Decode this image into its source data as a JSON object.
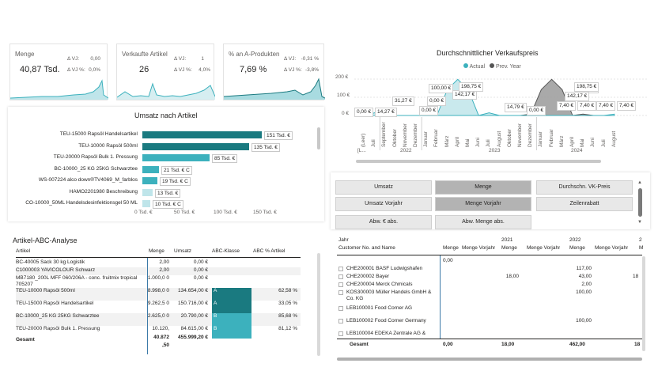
{
  "kpis": [
    {
      "title": "Menge",
      "value": "40,87 Tsd.",
      "d1_label": "Δ VJ:",
      "d1_value": "0,00",
      "d2_label": "Δ VJ %:",
      "d2_value": "0,0%"
    },
    {
      "title": "Verkaufte Artikel",
      "value": "26",
      "d1_label": "Δ VJ:",
      "d1_value": "1",
      "d2_label": "Δ VJ %:",
      "d2_value": "4,0%"
    },
    {
      "title": "% an A-Produkten",
      "value": "7,69 %",
      "d1_label": "Δ VJ:",
      "d1_value": "-0,31 %",
      "d2_label": "Δ VJ %:",
      "d2_value": "-3,8%"
    }
  ],
  "umsatz": {
    "title": "Umsatz nach Artikel",
    "chart_data": {
      "type": "bar",
      "categories": [
        "TEU-15000 Rapsöl Handelsartikel",
        "TEU-10000 Rapsöl 500ml",
        "TEU-20000 Rapsöl Bulk 1. Pressung",
        "BC-10000_25 KG 25KG Schwarztee",
        "WS-007224 alco down®TV4069_M_farblos",
        "HAMO2201980 Beschreibung",
        "CO-10000_50ML Handelsdesinfektionsgel 50 ML"
      ],
      "values": [
        151,
        135,
        85,
        21,
        19,
        13,
        10
      ],
      "labels": [
        "151 Tsd. €",
        "135 Tsd. €",
        "85 Tsd. €",
        "21 Tsd. € C",
        "19 Tsd. € C",
        "13 Tsd. €",
        "10 Tsd. € C"
      ],
      "ticks": [
        "0 Tsd. €",
        "50 Tsd. €",
        "100 Tsd. €",
        "150 Tsd. €"
      ],
      "xlim": [
        0,
        150
      ]
    },
    "colors": [
      "#1a7a80",
      "#1a7a80",
      "#3cb1bd",
      "#3cb1bd",
      "#3cb1bd",
      "#bfe5ea",
      "#bfe5ea"
    ]
  },
  "vk": {
    "title": "Durchschnittlicher Verkaufspreis",
    "legend_actual": "Actual",
    "legend_prev": "Prev. Year",
    "color_actual": "#3cb1bd",
    "color_prev": "#555555",
    "y_ticks": [
      "200 €",
      "100 €",
      "0 €"
    ],
    "chart_data": {
      "type": "area",
      "categories": [
        "(Leer)",
        "Juli",
        "September",
        "Oktober",
        "November",
        "Dezember",
        "Januar",
        "Februar",
        "März",
        "April",
        "Mai",
        "Juni",
        "Juli",
        "August",
        "Oktober",
        "November",
        "Dezember",
        "Januar",
        "Februar",
        "März",
        "April",
        "Mai",
        "Juni",
        "Juli",
        "August"
      ],
      "ylim": [
        0,
        200
      ],
      "series": [
        {
          "name": "Actual",
          "values": [
            0,
            14.27,
            31.27,
            0,
            0,
            0,
            0,
            0,
            142.17,
            198.75,
            142.17,
            0,
            14.79,
            0,
            0,
            0,
            0,
            0,
            0,
            0,
            0,
            0,
            0,
            0,
            7.4
          ]
        },
        {
          "name": "Prev. Year",
          "values": [
            0,
            0,
            0,
            0,
            0,
            0,
            0,
            0,
            0,
            0,
            0,
            0,
            0,
            0,
            0,
            0,
            7.4,
            142.17,
            198.75,
            142.17,
            0,
            7.4,
            0,
            0,
            0
          ]
        }
      ]
    },
    "tooltips": [
      "0,00 €",
      "14,27 €",
      "31,27 €",
      "0,00 €",
      "100,00 €",
      "0,00 €",
      "142,17 €",
      "198,75 €",
      "14,79 €",
      "0,00 €",
      "100,00 €",
      "7,40 €",
      "142,17 €",
      "198,75 €",
      "7,40 €",
      "7,40 €",
      "7,40 €"
    ],
    "years": [
      "[L...",
      "2022",
      "2023",
      "2024"
    ]
  },
  "abc": {
    "title": "Artikel-ABC-Analyse",
    "headers": [
      "Artikel",
      "Menge",
      "Umsatz",
      "ABC-Klasse",
      "ABC % Artikel"
    ],
    "rows": [
      {
        "artikel": "BC-40005 Sack 30 kg Logistik",
        "menge": "2,00",
        "umsatz": "0,00 €",
        "klasse": "",
        "pct": ""
      },
      {
        "artikel": "C1000003 YAVICOLOUR Schwarz",
        "menge": "2,00",
        "umsatz": "0,00 €",
        "klasse": "",
        "pct": ""
      },
      {
        "artikel": "MB7180_200L MFF 060/206A - conc. fruitmix tropical 705207",
        "menge": "1.000,0 0",
        "umsatz": "0,00 €",
        "klasse": "",
        "pct": ""
      },
      {
        "artikel": "TEU-10000 Rapsöl 500ml",
        "menge": "8.998,0 0",
        "umsatz": "134.654,00 €",
        "klasse": "A",
        "pct": "62,58 %"
      },
      {
        "artikel": "TEU-15000 Rapsöl Handelsartikel",
        "menge": "9.262,5 0",
        "umsatz": "150.716,00 €",
        "klasse": "A",
        "pct": "33,05 %"
      },
      {
        "artikel": "BC-10000_25 KG 25KG Schwarztee",
        "menge": "2.625,0 0",
        "umsatz": "20.790,00 €",
        "klasse": "B",
        "pct": "85,68 %"
      },
      {
        "artikel": "TEU-20000 Rapsöl Bulk 1. Pressung",
        "menge": "10.120,",
        "umsatz": "84.615,00 €",
        "klasse": "B",
        "pct": "81,12 %"
      }
    ],
    "total_label": "Gesamt",
    "total_menge": "40.872 ,50",
    "total_umsatz": "455.999,20 €"
  },
  "buttons": [
    {
      "label": "Umsatz",
      "selected": false
    },
    {
      "label": "Menge",
      "selected": true
    },
    {
      "label": "Durchschn. VK-Preis",
      "selected": false
    },
    {
      "label": "Umsatz Vorjahr",
      "selected": false
    },
    {
      "label": "Menge Vorjahr",
      "selected": true
    },
    {
      "label": "Zeilenrabatt",
      "selected": false
    },
    {
      "label": "Abw. € abs.",
      "selected": false
    },
    {
      "label": "Abw. Menge abs.",
      "selected": false
    }
  ],
  "matrix": {
    "header_jahr": "Jahr",
    "header_customer": "Customer No. and Name",
    "year_2021": "2021",
    "year_2022": "2022",
    "year_2022_abbr": "2",
    "col_menge": "Menge",
    "col_menge_vj": "Menge Vorjahr",
    "col_m": "M",
    "first_row": "0,00",
    "rows": [
      {
        "name": "CHE200001 BASF Ludwigshafen",
        "v2021": "",
        "v2022": "117,00",
        "v2022vj": ""
      },
      {
        "name": "CHE200002 Bayer",
        "v2021": "18,00",
        "v2022": "43,00",
        "v2022vj": "18"
      },
      {
        "name": "CHE200004 Merck Chmicals",
        "v2021": "",
        "v2022": "2,00",
        "v2022vj": ""
      },
      {
        "name": "KOS300003 Müller Handels GmbH & Co. KG",
        "v2021": "",
        "v2022": "100,00",
        "v2022vj": ""
      },
      {
        "name": "LEB100001 Food Corner AG",
        "v2021": "",
        "v2022": "",
        "v2022vj": ""
      },
      {
        "name": "LEB100002 Food Corner Germany",
        "v2021": "",
        "v2022": "100,00",
        "v2022vj": ""
      },
      {
        "name": "LEB100004 EDEKA Zentrale AG &",
        "v2021": "",
        "v2022": "",
        "v2022vj": ""
      }
    ],
    "total_label": "Gesamt",
    "total_menge": "0,00",
    "total_vj": "18,00",
    "total_2022": "462,00",
    "total_2022vj": "18"
  }
}
